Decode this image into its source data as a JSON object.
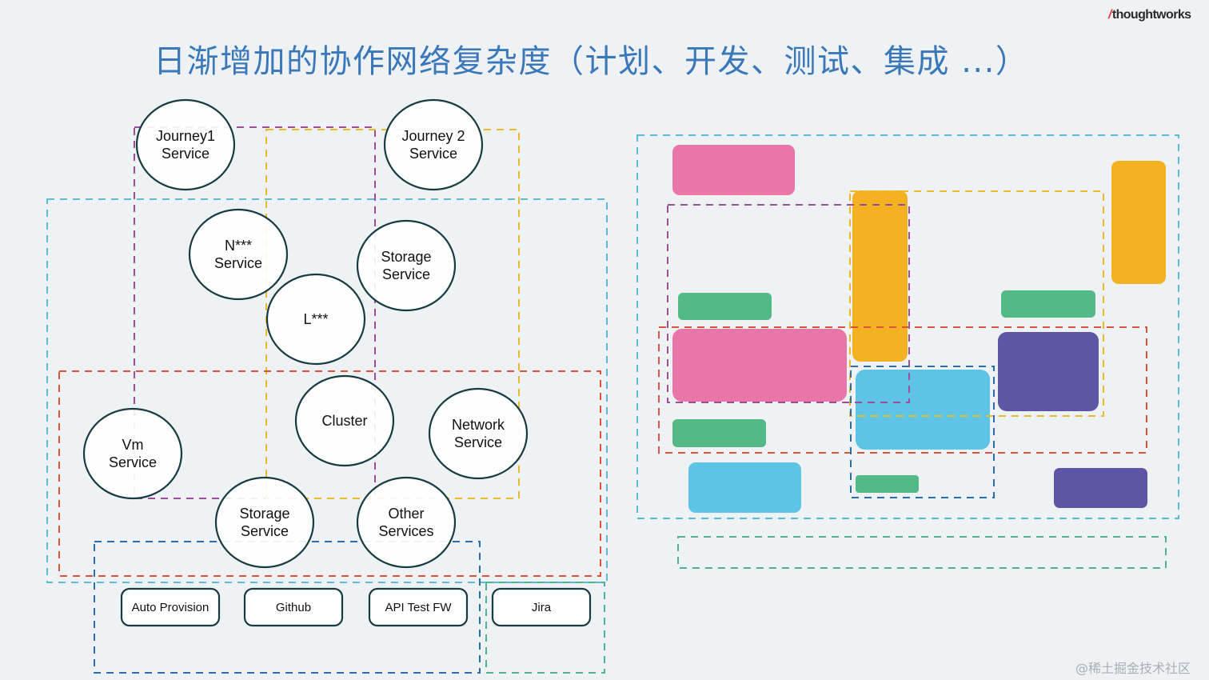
{
  "slide": {
    "title": "日渐增加的协作网络复杂度（计划、开发、测试、集成 ...）",
    "logo": {
      "slash": "/",
      "text": "thoughtworks"
    },
    "watermark": "@稀土掘金技术社区"
  },
  "colors": {
    "title": "#3b78b9",
    "background": "#eef2f5",
    "node_stroke": "#163b42",
    "group_cyan": "#5bbad6",
    "group_purple": "#9c4d9c",
    "group_yellow": "#eeb730",
    "group_red": "#d9523a",
    "group_blue": "#2a6fad",
    "group_green": "#4fb48c",
    "block_pink": "#e876a7",
    "block_yellow": "#f4b223",
    "block_green": "#52b987",
    "block_skyblue": "#5ec4e6",
    "block_purple": "#5c57a4"
  },
  "left_diagram": {
    "services": [
      {
        "id": "journey1",
        "lines": [
          "Journey1",
          "Service"
        ]
      },
      {
        "id": "journey2",
        "lines": [
          "Journey 2",
          "Service"
        ]
      },
      {
        "id": "n-service",
        "lines": [
          "N***",
          "Service"
        ]
      },
      {
        "id": "storage-top",
        "lines": [
          "Storage",
          "Service"
        ]
      },
      {
        "id": "l-service",
        "lines": [
          "L***"
        ]
      },
      {
        "id": "cluster",
        "lines": [
          "Cluster"
        ]
      },
      {
        "id": "network",
        "lines": [
          "Network",
          "Service"
        ]
      },
      {
        "id": "vm",
        "lines": [
          "Vm",
          "Service"
        ]
      },
      {
        "id": "storage-bottom",
        "lines": [
          "Storage",
          "Service"
        ]
      },
      {
        "id": "other",
        "lines": [
          "Other",
          "Services"
        ]
      }
    ],
    "tools": [
      {
        "id": "auto-provision",
        "label": "Auto Provision"
      },
      {
        "id": "github",
        "label": "Github"
      },
      {
        "id": "api-test-fw",
        "label": "API Test FW"
      },
      {
        "id": "jira",
        "label": "Jira"
      }
    ],
    "groups": [
      "cyan",
      "purple",
      "yellow",
      "red",
      "blue",
      "green"
    ]
  },
  "right_diagram": {
    "blocks": [
      "pink",
      "yellow",
      "green",
      "skyblue",
      "purple"
    ],
    "groups": [
      "cyan",
      "purple",
      "yellow",
      "red",
      "blue",
      "green"
    ]
  }
}
